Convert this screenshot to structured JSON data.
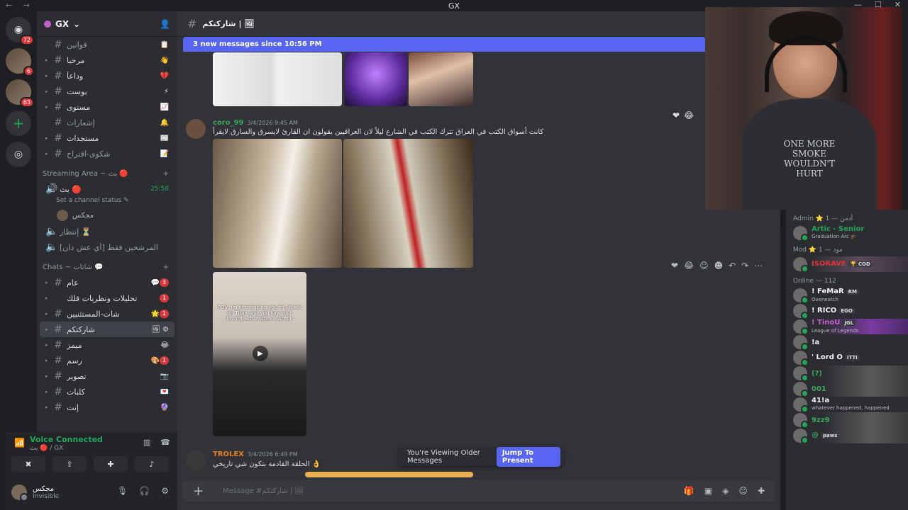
{
  "window": {
    "title": "GX"
  },
  "guilds": [
    {
      "name": "discord-home",
      "badge": "72"
    },
    {
      "name": "server-1",
      "badge": "6"
    },
    {
      "name": "server-2",
      "badge": "63"
    }
  ],
  "server": {
    "name": "GX"
  },
  "channels": [
    {
      "name": "قوانين",
      "emoji": "📋",
      "kind": "text",
      "collapsed": false,
      "state": "dim"
    },
    {
      "name": "مرحبا",
      "emoji": "👋",
      "kind": "text",
      "collapsed": true,
      "state": "bright"
    },
    {
      "name": "وداعاً",
      "emoji": "💔",
      "kind": "text",
      "collapsed": true,
      "state": "bright"
    },
    {
      "name": "بوست",
      "emoji": "⚡",
      "kind": "text",
      "collapsed": true,
      "state": "bright"
    },
    {
      "name": "مستوى",
      "emoji": "📈",
      "kind": "text",
      "collapsed": true,
      "state": "bright"
    },
    {
      "name": "إشعارات",
      "emoji": "🔔",
      "kind": "text",
      "collapsed": false,
      "state": "dim"
    },
    {
      "name": "مستجدات",
      "emoji": "📰",
      "kind": "text",
      "collapsed": true,
      "state": "bright"
    },
    {
      "name": "شكوى-اقتراح",
      "emoji": "📝",
      "kind": "text",
      "collapsed": true,
      "state": "dim"
    }
  ],
  "streaming_category": {
    "label": "Streaming Area ~ بث 🔴"
  },
  "voice_channel": {
    "name": "بث 🔴",
    "status": "Set a channel status ✎",
    "timer": "25:58",
    "user": "مجكس"
  },
  "voice_extra": [
    {
      "name": "إنتظار ⏳"
    },
    {
      "name": "المرشحين فقط [أي عش دان]"
    }
  ],
  "chats_category": {
    "label": "Chats ~ شاتات 💬"
  },
  "chat_channels": [
    {
      "name": "عام",
      "emoji": "💬",
      "count": "3"
    },
    {
      "name": "تحليلات ونظريات فلك",
      "emoji": "",
      "count": "1"
    },
    {
      "name": "شات-المستثنيين",
      "emoji": "🌟",
      "count": "1"
    },
    {
      "name": "شاركتكم",
      "emoji": "🖼",
      "count": ""
    },
    {
      "name": "ميمز",
      "emoji": "😂",
      "count": ""
    },
    {
      "name": "رسم",
      "emoji": "🎨",
      "count": "1"
    },
    {
      "name": "تصوير",
      "emoji": "📷",
      "count": ""
    },
    {
      "name": "كلبات",
      "emoji": "💌",
      "count": ""
    },
    {
      "name": "إنت",
      "emoji": "🔮",
      "count": ""
    }
  ],
  "voice_connected": {
    "title": "Voice Connected",
    "sub": "بث 🔴 / GX"
  },
  "user": {
    "name": "مجكس",
    "status": "Invisible"
  },
  "main": {
    "channel": "شاركتكم | 🖼",
    "new_messages": "3 new messages since 10:56 PM",
    "messages": [
      {
        "author": "coro_99",
        "timestamp": "3/4/2026 9:45 AM",
        "text": "كانت أسواق الكتب في العراق تترك الكتب في الشارع ليلاً لان العراقيين يقولون ان القارئ لايسرق والسارق لايقرأ",
        "color": "#3ba55c"
      },
      {
        "author": "TROLEX",
        "timestamp": "3/4/2026 6:49 PM",
        "text": "الحلقة القادمة بتكون شي تاريخي 👌",
        "color": "#e67e22"
      }
    ],
    "video_caption": "POV: Im introducing you to Attack on Titan and you say your favorite character is Armin",
    "older_banner": "You're Viewing Older Messages",
    "jump_label": "Jump To Present",
    "composer_placeholder": "Message #شاركتكم | 🖼"
  },
  "stream": {
    "shirt_text": "ONE MORE SMOKE WOULDN'T HURT"
  },
  "members": {
    "admin_header": "Admin ⭐ أدمن — 1",
    "admin": [
      {
        "name": "Artic - Senior",
        "activity": "Graduation Arc 🎓",
        "color": "#23a559"
      }
    ],
    "mod_header": "Mod ⭐ مود — 1",
    "mod": [
      {
        "name": "ISORAVE",
        "tag": "🏆 COD",
        "color": "#da373c"
      }
    ],
    "online_header": "Online — 112",
    "online": [
      {
        "name": "! FeMaR",
        "tag": "RM",
        "activity": "Overwatch",
        "color": "#f2f3f5"
      },
      {
        "name": "! RICO",
        "tag": "EGO",
        "activity": "",
        "color": "#f2f3f5"
      },
      {
        "name": "! TinoU",
        "tag": "JGL",
        "activity": "League of Legends",
        "color": "#c061cb"
      },
      {
        "name": "!a",
        "tag": "",
        "activity": "",
        "color": "#f2f3f5"
      },
      {
        "name": "' Lord O",
        "tag": "ITTI",
        "activity": "",
        "color": "#f2f3f5"
      },
      {
        "name": "(?)",
        "tag": "",
        "activity": "",
        "color": "#3ba55c"
      },
      {
        "name": "001",
        "tag": "",
        "activity": "",
        "color": "#3ba55c"
      },
      {
        "name": "41!a",
        "tag": "",
        "activity": "whatever happened, happened",
        "color": "#f2f3f5"
      },
      {
        "name": "9zz9",
        "tag": "",
        "activity": "",
        "color": "#3ba55c"
      },
      {
        "name": "@",
        "tag": "paws",
        "activity": "",
        "color": "#3ba55c"
      }
    ]
  }
}
